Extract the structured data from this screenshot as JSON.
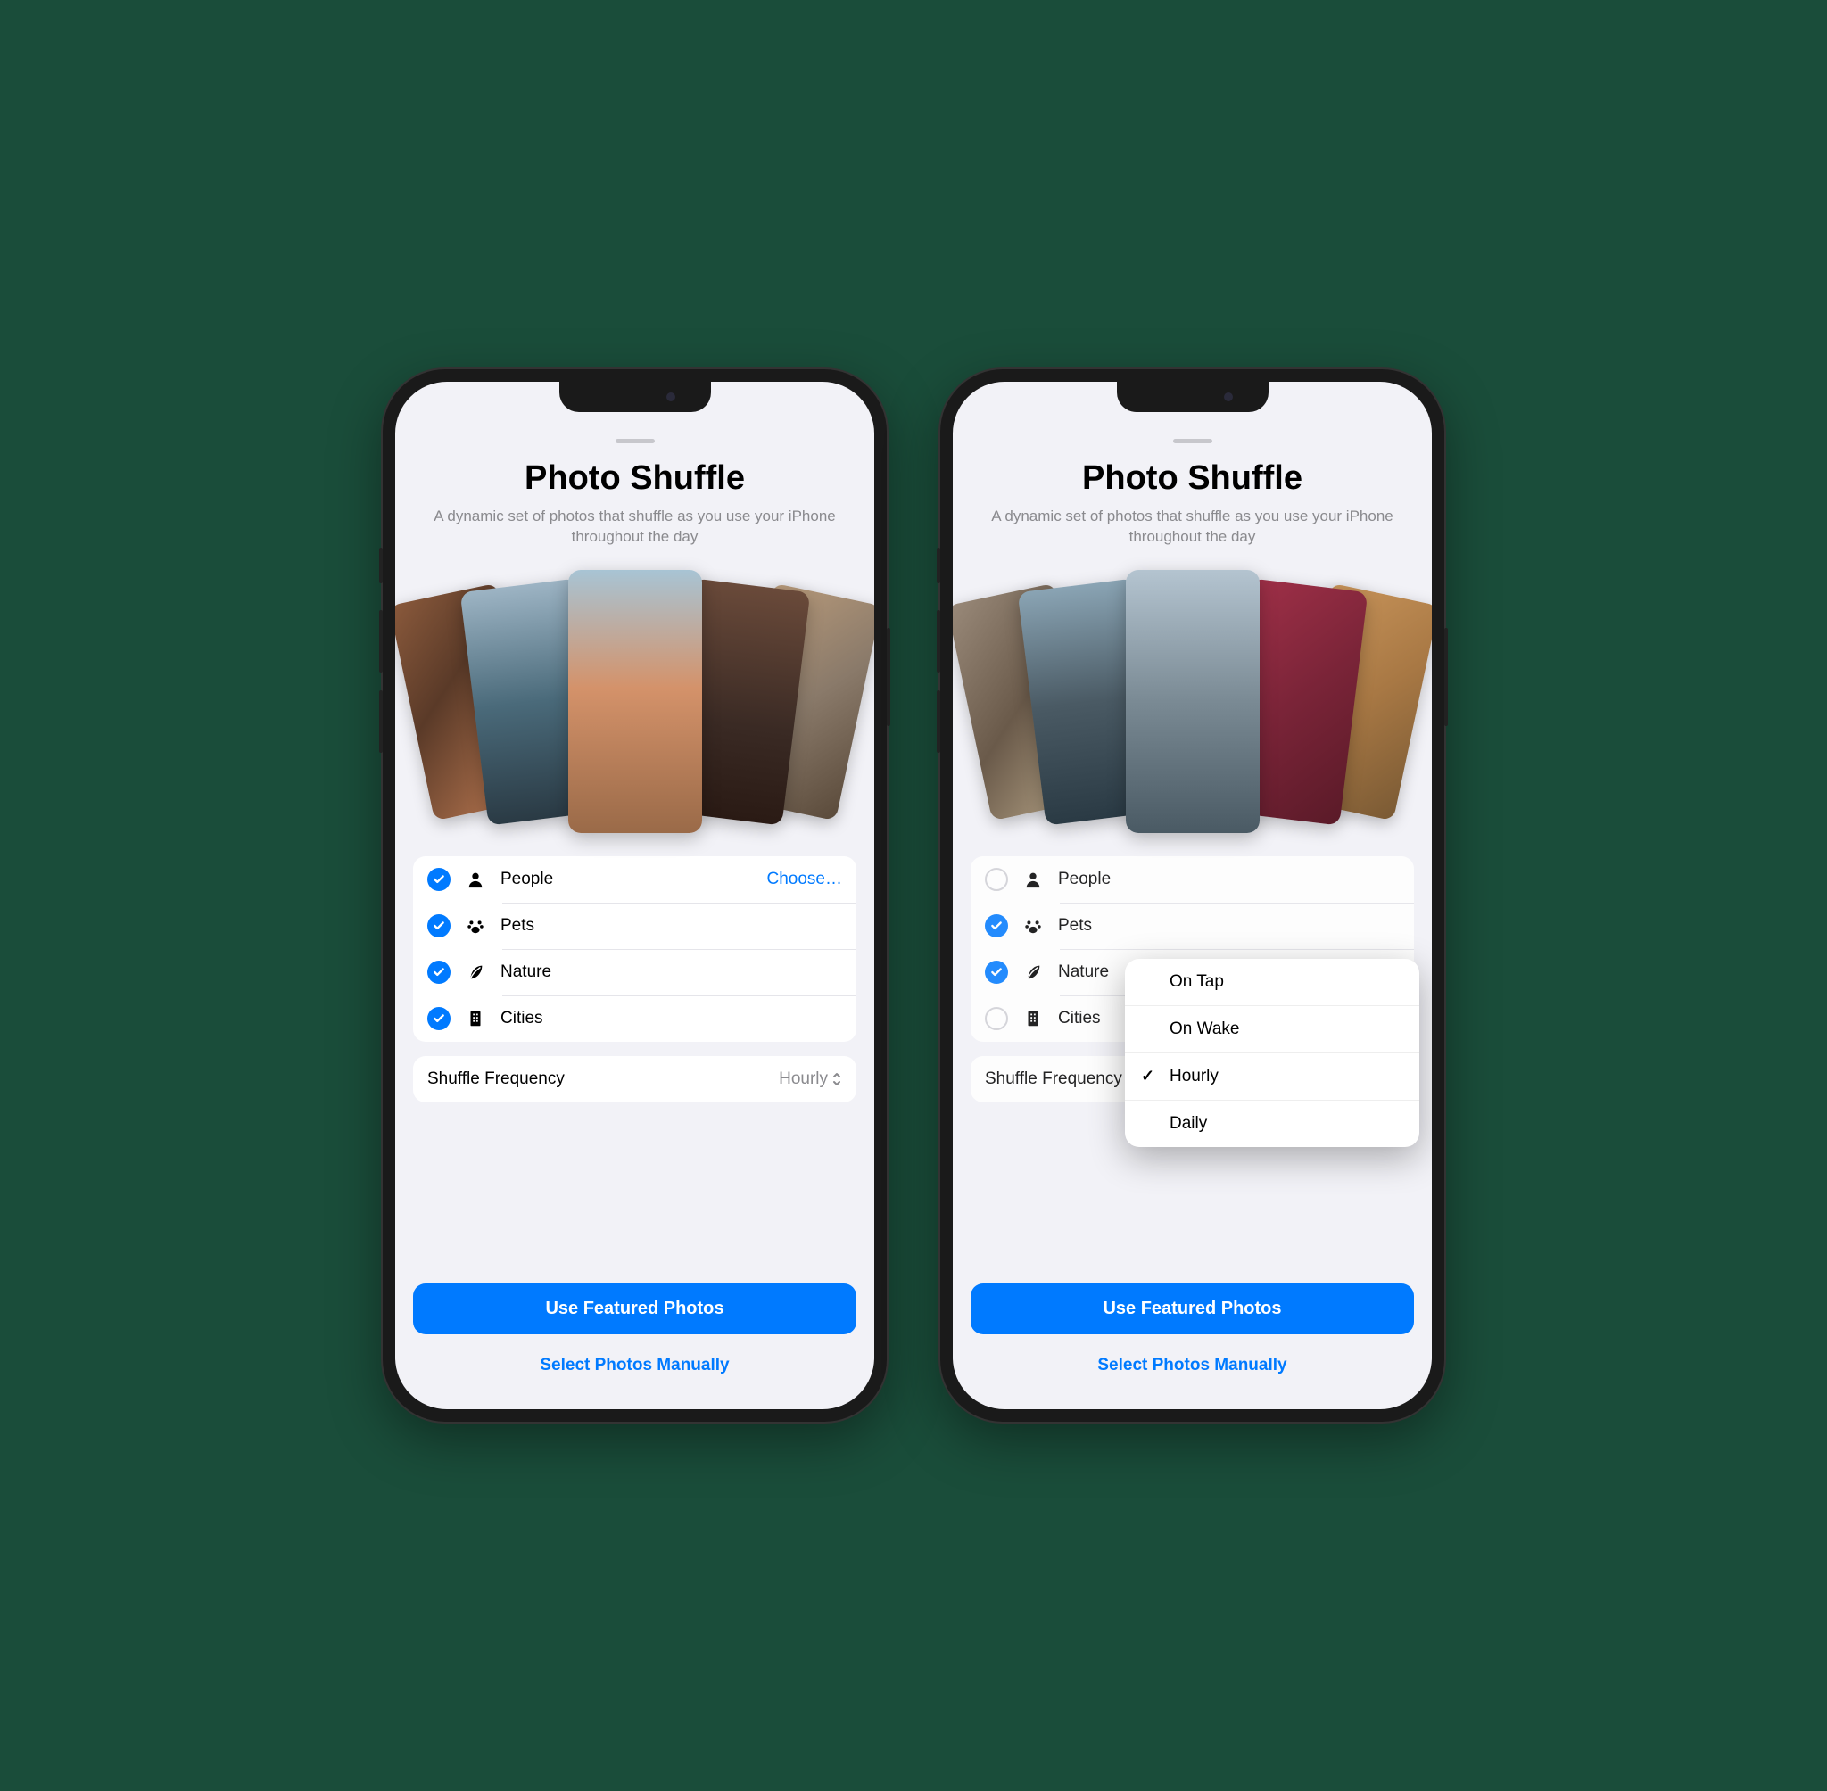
{
  "title": "Photo Shuffle",
  "subtitle": "A dynamic set of photos that shuffle as you use your iPhone throughout the day",
  "categories_left": [
    {
      "label": "People",
      "checked": true,
      "action": "Choose…"
    },
    {
      "label": "Pets",
      "checked": true
    },
    {
      "label": "Nature",
      "checked": true
    },
    {
      "label": "Cities",
      "checked": true
    }
  ],
  "categories_right": [
    {
      "label": "People",
      "checked": false
    },
    {
      "label": "Pets",
      "checked": true
    },
    {
      "label": "Nature",
      "checked": true
    },
    {
      "label": "Cities",
      "checked": false
    }
  ],
  "frequency": {
    "label": "Shuffle Frequency",
    "value": "Hourly"
  },
  "frequency_menu": [
    {
      "label": "On Tap",
      "selected": false
    },
    {
      "label": "On Wake",
      "selected": false
    },
    {
      "label": "Hourly",
      "selected": true
    },
    {
      "label": "Daily",
      "selected": false
    }
  ],
  "buttons": {
    "primary": "Use Featured Photos",
    "secondary": "Select Photos Manually"
  }
}
